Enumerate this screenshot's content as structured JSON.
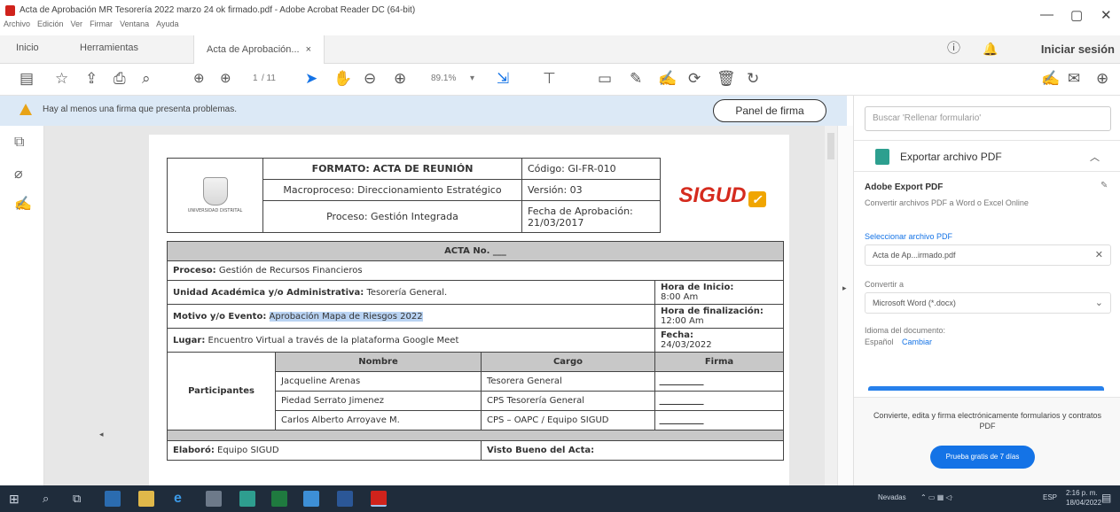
{
  "window": {
    "title": "Acta de Aprobación MR Tesorería 2022 marzo 24 ok firmado.pdf - Adobe Acrobat Reader DC (64-bit)",
    "menus": [
      "Archivo",
      "Edición",
      "Ver",
      "Firmar",
      "Ventana",
      "Ayuda"
    ],
    "controls": [
      "—",
      "▢",
      "✕"
    ]
  },
  "tabs": {
    "home": "Inicio",
    "tools": "Herramientas",
    "doc": "Acta de Aprobación...",
    "doc_close": "×",
    "signin": "Iniciar sesión"
  },
  "toolbar": {
    "page_current": "1",
    "page_total": "/ 11",
    "zoom": "89.1%"
  },
  "warning": {
    "message": "Hay al menos una firma que presenta problemas.",
    "button": "Panel de firma"
  },
  "document": {
    "header": {
      "university": "UNIVERSIDAD DISTRITAL",
      "format_title": "FORMATO: ACTA DE REUNIÓN",
      "macroprocess": "Macroproceso: Direccionamiento Estratégico",
      "process": "Proceso: Gestión Integrada",
      "code": "Código: GI-FR-010",
      "version": "Versión: 03",
      "approval_date": "Fecha de Aprobación: 21/03/2017",
      "brand": "SIGUD"
    },
    "acta": {
      "title": "ACTA No. ___",
      "proceso_label": "Proceso:",
      "proceso_value": "Gestión de Recursos Financieros",
      "unidad_label": "Unidad Académica y/o Administrativa:",
      "unidad_value": "Tesorería General.",
      "hora_inicio_label": "Hora de Inicio:",
      "hora_inicio_value": "8:00 Am",
      "motivo_label": "Motivo y/o Evento:",
      "motivo_value": "Aprobación Mapa de Riesgos 2022",
      "hora_fin_label": "Hora de finalización:",
      "hora_fin_value": "12:00 Am",
      "lugar_label": "Lugar:",
      "lugar_value": "Encuentro Virtual a través de la plataforma Google Meet",
      "fecha_label": "Fecha:",
      "fecha_value": "24/03/2022",
      "participants_label": "Participantes",
      "col_nombre": "Nombre",
      "col_cargo": "Cargo",
      "col_firma": "Firma",
      "participants": [
        {
          "nombre": "Jacqueline Arenas",
          "cargo": "Tesorera General"
        },
        {
          "nombre": "Piedad Serrato Jimenez",
          "cargo": "CPS Tesorería General"
        },
        {
          "nombre": "Carlos Alberto Arroyave M.",
          "cargo": "CPS – OAPC / Equipo SIGUD"
        }
      ],
      "elaboro_label": "Elaboró:",
      "elaboro_value": "Equipo SIGUD",
      "visto_bueno": "Visto Bueno del Acta:"
    }
  },
  "right_panel": {
    "search_placeholder": "Buscar 'Rellenar formulario'",
    "export_title": "Exportar archivo PDF",
    "service_title": "Adobe Export PDF",
    "service_desc": "Convertir archivos PDF a Word o Excel Online",
    "select_label": "Seleccionar archivo PDF",
    "selected_file": "Acta de Ap...irmado.pdf",
    "convert_label": "Convertir a",
    "convert_value": "Microsoft Word (*.docx)",
    "lang_label": "Idioma del documento:",
    "lang_value": "Español",
    "lang_change": "Cambiar",
    "promo_text": "Convierte, edita y firma electrónicamente formularios y contratos PDF",
    "promo_button": "Prueba gratis de 7 días"
  },
  "taskbar": {
    "weather": "Nevadas",
    "lang": "ESP",
    "time": "2:16 p. m.",
    "date": "18/04/2022"
  }
}
